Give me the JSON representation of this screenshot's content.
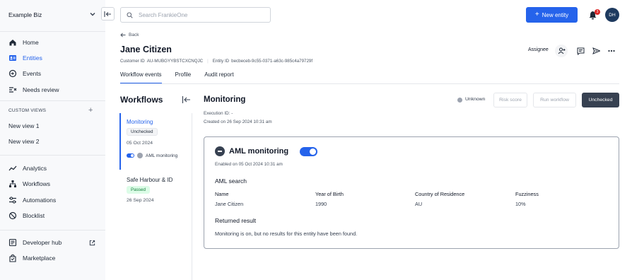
{
  "sidebar": {
    "org_name": "Example Biz",
    "main_nav": [
      {
        "label": "Home",
        "icon": "home-icon",
        "active": false
      },
      {
        "label": "Entities",
        "icon": "entities-icon",
        "active": true
      },
      {
        "label": "Events",
        "icon": "events-icon",
        "active": false
      },
      {
        "label": "Needs review",
        "icon": "needs-review-icon",
        "active": false
      }
    ],
    "custom_views_label": "CUSTOM VIEWS",
    "custom_views": [
      {
        "label": "New view 1"
      },
      {
        "label": "New view 2"
      }
    ],
    "secondary_nav": [
      {
        "label": "Analytics",
        "icon": "analytics-icon"
      },
      {
        "label": "Workflows",
        "icon": "workflows-icon"
      },
      {
        "label": "Automations",
        "icon": "automations-icon"
      },
      {
        "label": "Blocklist",
        "icon": "blocklist-icon"
      }
    ],
    "footer_nav": [
      {
        "label": "Developer hub",
        "icon": "developer-hub-icon"
      },
      {
        "label": "Marketplace",
        "icon": "marketplace-icon"
      }
    ]
  },
  "topbar": {
    "search_placeholder": "Search FrankieOne",
    "new_entity_label": "New entity",
    "notification_count": "3",
    "avatar_initials": "DH"
  },
  "entity": {
    "back_label": "Back",
    "name": "Jane Citizen",
    "customer_id_label": "Customer ID",
    "customer_id": "AU-MUBGYYBSTCXCNQJC",
    "entity_id_label": "Entity ID",
    "entity_id": "becbeceb-9c55-0371-a63c-985c4a79729f",
    "assignee_label": "Assignee"
  },
  "tabs": [
    {
      "label": "Workflow events",
      "active": true
    },
    {
      "label": "Profile",
      "active": false
    },
    {
      "label": "Audit report",
      "active": false
    }
  ],
  "workflows": {
    "title": "Workflows",
    "items": [
      {
        "title": "Monitoring",
        "status": "Unchecked",
        "date": "05 Oct 2024",
        "step": "AML monitoring"
      },
      {
        "title": "Safe Harbour & ID",
        "status": "Passed",
        "date": "26 Sep 2024"
      }
    ]
  },
  "monitoring": {
    "title": "Monitoring",
    "status_label": "Unknown",
    "risk_score_label": "Risk score",
    "run_workflow_label": "Run workflow",
    "result_label": "Unchecked",
    "execution_id": "Execution ID: -",
    "created_on": "Created on 26 Sep 2024 10:31 am",
    "aml": {
      "title": "AML monitoring",
      "toggle_on": true,
      "enabled_on": "Enabled on 05 Oct 2024 10:31 am",
      "search_heading": "AML search",
      "columns": [
        "Name",
        "Year of Birth",
        "Country of Residence",
        "Fuzziness"
      ],
      "values": [
        "Jane Citizen",
        "1990",
        "AU",
        "10%"
      ],
      "returned_heading": "Returned result",
      "returned_message": "Monitoring is on, but no results for this entity have been found."
    }
  },
  "colors": {
    "accent": "#2563eb",
    "dark_button": "#374151",
    "passed_bg": "#dcfce7",
    "passed_text": "#15803d",
    "badge_red": "#dc2626"
  }
}
